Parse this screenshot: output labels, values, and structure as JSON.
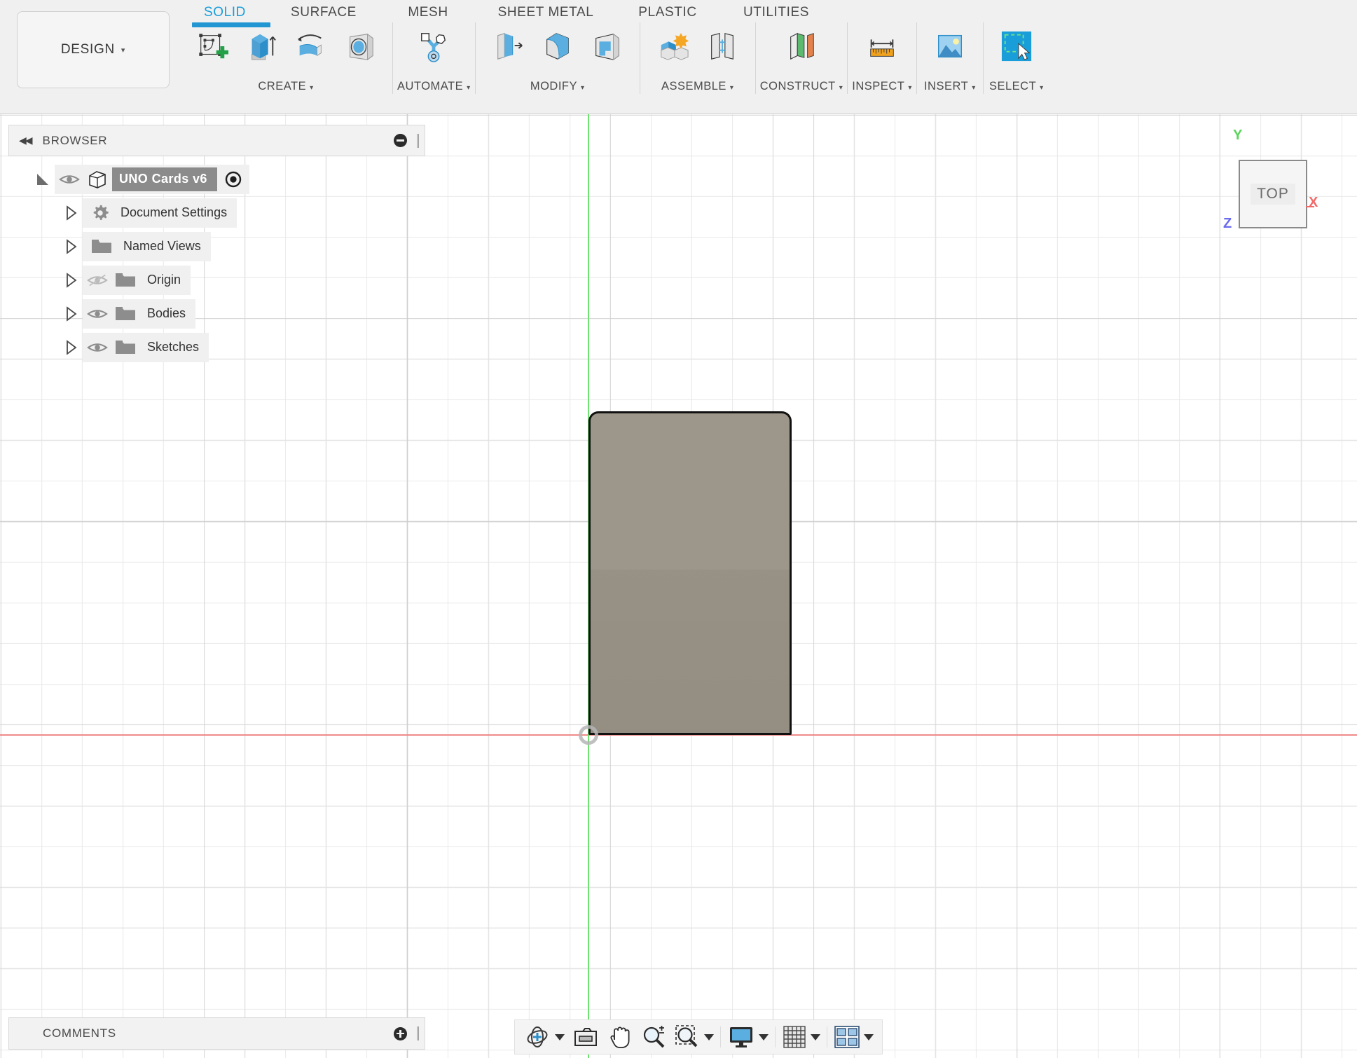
{
  "app": {
    "workspace_button": "DESIGN",
    "workspace_caret": "▾"
  },
  "tabs": [
    {
      "label": "SOLID",
      "active": true,
      "name": "tab-solid"
    },
    {
      "label": "SURFACE",
      "active": false,
      "name": "tab-surface"
    },
    {
      "label": "MESH",
      "active": false,
      "name": "tab-mesh"
    },
    {
      "label": "SHEET METAL",
      "active": false,
      "name": "tab-sheet-metal"
    },
    {
      "label": "PLASTIC",
      "active": false,
      "name": "tab-plastic"
    },
    {
      "label": "UTILITIES",
      "active": false,
      "name": "tab-utilities"
    }
  ],
  "ribbon": {
    "groups": [
      {
        "label": "CREATE",
        "caret": "▾",
        "tools": [
          "create-sketch",
          "extrude",
          "revolve",
          "hole"
        ]
      },
      {
        "label": "AUTOMATE",
        "caret": "▾",
        "tools": [
          "automate-assembly"
        ]
      },
      {
        "label": "MODIFY",
        "caret": "▾",
        "tools": [
          "press-pull",
          "fillet",
          "shell"
        ]
      },
      {
        "label": "ASSEMBLE",
        "caret": "▾",
        "tools": [
          "new-component",
          "joint"
        ]
      },
      {
        "label": "CONSTRUCT",
        "caret": "▾",
        "tools": [
          "offset-plane"
        ]
      },
      {
        "label": "INSPECT",
        "caret": "▾",
        "tools": [
          "measure"
        ]
      },
      {
        "label": "INSERT",
        "caret": "▾",
        "tools": [
          "insert-canvas"
        ]
      },
      {
        "label": "SELECT",
        "caret": "▾",
        "tools": [
          "select-window"
        ]
      }
    ]
  },
  "browser": {
    "title": "BROWSER",
    "collapse_icon": "◀◀",
    "minus_icon": "minus-circle",
    "grip_icon": "panel-grip",
    "tree": [
      {
        "label": "UNO Cards v6",
        "indent": 0,
        "twisty": "down",
        "eye": "visible",
        "type_icon": "component-cube",
        "selected": true,
        "has_activate_radio": true,
        "name": "tree-item-uno-cards-v6"
      },
      {
        "label": "Document Settings",
        "indent": 1,
        "twisty": "right",
        "eye": "none",
        "type_icon": "gear",
        "selected": false,
        "has_activate_radio": false,
        "name": "tree-item-document-settings"
      },
      {
        "label": "Named Views",
        "indent": 1,
        "twisty": "right",
        "eye": "none",
        "type_icon": "folder",
        "selected": false,
        "has_activate_radio": false,
        "name": "tree-item-named-views"
      },
      {
        "label": "Origin",
        "indent": 1,
        "twisty": "right",
        "eye": "hidden",
        "type_icon": "folder",
        "selected": false,
        "has_activate_radio": false,
        "name": "tree-item-origin"
      },
      {
        "label": "Bodies",
        "indent": 1,
        "twisty": "right",
        "eye": "visible",
        "type_icon": "folder",
        "selected": false,
        "has_activate_radio": false,
        "name": "tree-item-bodies"
      },
      {
        "label": "Sketches",
        "indent": 1,
        "twisty": "right",
        "eye": "visible",
        "type_icon": "folder",
        "selected": false,
        "has_activate_radio": false,
        "name": "tree-item-sketches"
      }
    ]
  },
  "viewcube": {
    "face_label": "TOP",
    "axis_y": "Y",
    "axis_z": "Z",
    "axis_x": "X"
  },
  "comments": {
    "title": "COMMENTS",
    "plus_icon": "plus-circle",
    "grip_icon": "panel-grip"
  },
  "navbar": {
    "items": [
      {
        "icon": "orbit-icon",
        "caret": true,
        "name": "nav-orbit"
      },
      {
        "icon": "look-at-icon",
        "caret": false,
        "name": "nav-look-at"
      },
      {
        "icon": "pan-hand-icon",
        "caret": false,
        "name": "nav-pan"
      },
      {
        "icon": "zoom-icon",
        "caret": false,
        "name": "nav-zoom"
      },
      {
        "icon": "zoom-window-icon",
        "caret": true,
        "name": "nav-fit"
      },
      {
        "icon": "display-settings-icon",
        "caret": true,
        "name": "nav-display-settings"
      },
      {
        "icon": "grid-snaps-icon",
        "caret": true,
        "name": "nav-grid-snaps"
      },
      {
        "icon": "viewport-layout-icon",
        "caret": true,
        "name": "nav-viewport-layout"
      }
    ]
  },
  "canvas": {
    "body_name": "uno-card-body",
    "body_color": "#9d968a",
    "body_edge_color": "#111111",
    "axis_x_color": "#f08a8a",
    "axis_y_color": "#6fe36f",
    "grid_minor_color": "#e4e4e4",
    "grid_major_color": "#cfcfcf",
    "origin_marker": "origin-point"
  },
  "colors": {
    "accent": "#1a9ed9",
    "ribbon_bg": "#f0f0f0",
    "selection_bg": "#8b8b8b"
  }
}
